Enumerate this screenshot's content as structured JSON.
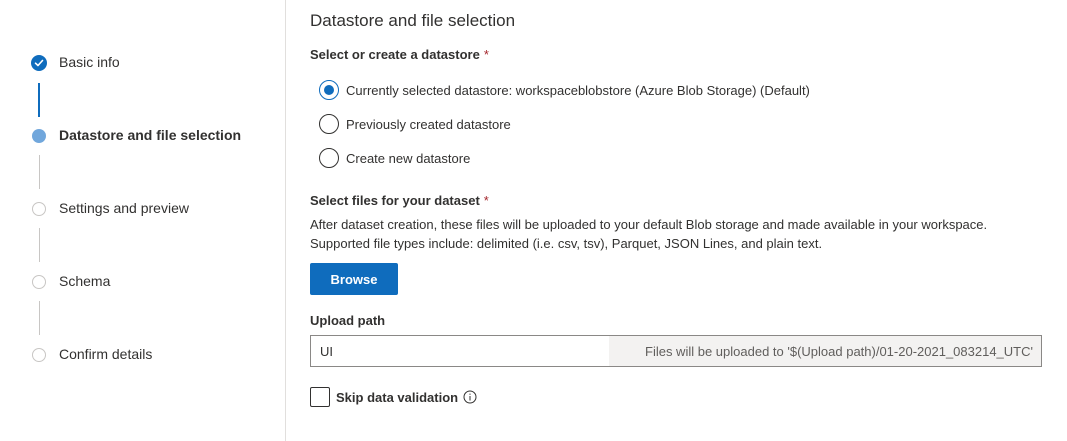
{
  "stepper": {
    "steps": [
      {
        "label": "Basic info",
        "state": "done"
      },
      {
        "label": "Datastore and file selection",
        "state": "current"
      },
      {
        "label": "Settings and preview",
        "state": "pending"
      },
      {
        "label": "Schema",
        "state": "pending"
      },
      {
        "label": "Confirm details",
        "state": "pending"
      }
    ]
  },
  "main": {
    "title": "Datastore and file selection",
    "datastore": {
      "label": "Select or create a datastore",
      "required_mark": "*",
      "options": [
        {
          "label": "Currently selected datastore: workspaceblobstore (Azure Blob Storage) (Default)",
          "checked": true
        },
        {
          "label": "Previously created datastore",
          "checked": false
        },
        {
          "label": "Create new datastore",
          "checked": false
        }
      ]
    },
    "files": {
      "label": "Select files for your dataset",
      "required_mark": "*",
      "help_line1": "After dataset creation, these files will be uploaded to your default Blob storage and made available in your workspace.",
      "help_line2": "Supported file types include: delimited (i.e. csv, tsv), Parquet, JSON Lines, and plain text.",
      "browse_label": "Browse"
    },
    "upload_path": {
      "label": "Upload path",
      "value": "UI",
      "suffix": "Files will be uploaded to '$(Upload path)/01-20-2021_083214_UTC'"
    },
    "skip_validation": {
      "label": "Skip data validation",
      "checked": false,
      "info_icon": "info-icon"
    }
  },
  "colors": {
    "accent": "#0f6cbd",
    "current_step": "#71a7dc",
    "required": "#a4262c"
  }
}
